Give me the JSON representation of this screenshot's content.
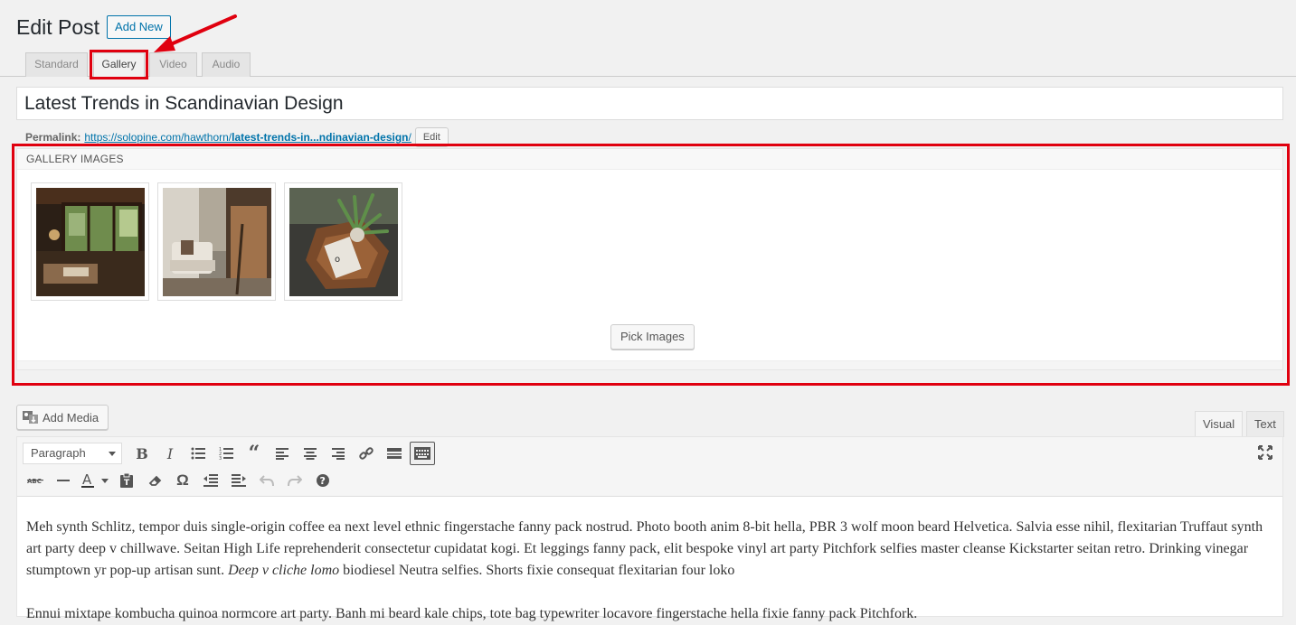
{
  "header": {
    "title": "Edit Post",
    "add_new_label": "Add New"
  },
  "format_tabs": [
    {
      "label": "Standard",
      "active": false
    },
    {
      "label": "Gallery",
      "active": true
    },
    {
      "label": "Video",
      "active": false
    },
    {
      "label": "Audio",
      "active": false
    }
  ],
  "post": {
    "title": "Latest Trends in Scandinavian Design",
    "permalink_label": "Permalink:",
    "permalink_base": "https://solopine.com/hawthorn/",
    "permalink_slug": "latest-trends-in...ndinavian-design",
    "permalink_trail": "/",
    "edit_label": "Edit"
  },
  "gallery": {
    "heading": "GALLERY IMAGES",
    "images": [
      {
        "alt": "wooden interior with windows"
      },
      {
        "alt": "white armchair and wooden chair"
      },
      {
        "alt": "plant on wooden tray with magazine"
      }
    ],
    "pick_label": "Pick Images"
  },
  "editor": {
    "add_media_label": "Add Media",
    "tab_visual": "Visual",
    "tab_text": "Text",
    "format_select": "Paragraph",
    "para1_a": "Meh synth Schlitz, tempor duis single-origin coffee ea next level ethnic fingerstache fanny pack nostrud. Photo booth anim 8-bit hella, PBR 3 wolf moon beard Helvetica. Salvia esse nihil, flexitarian Truffaut synth art party deep v chillwave. Seitan High Life reprehenderit consectetur cupidatat kogi. Et leggings fanny pack, elit bespoke vinyl art party Pitchfork selfies master cleanse Kickstarter seitan retro. Drinking vinegar stumptown yr pop-up artisan sunt. ",
    "para1_em": "Deep v cliche lomo",
    "para1_b": " biodiesel Neutra selfies. Shorts fixie consequat flexitarian four loko",
    "para2": "Ennui mixtape kombucha quinoa normcore art party. Banh mi beard kale chips, tote bag typewriter locavore fingerstache hella fixie fanny pack Pitchfork."
  },
  "colors": {
    "highlight": "#e0000f",
    "link": "#0073aa"
  }
}
